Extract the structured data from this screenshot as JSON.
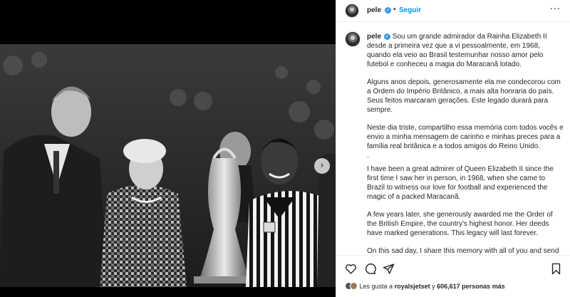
{
  "header": {
    "username": "pele",
    "separator": "•",
    "follow_label": "Seguir",
    "more_label": "···"
  },
  "caption": {
    "username": "pele",
    "paragraphs": [
      "Sou um grande admirador da Rainha Elizabeth II desde a primeira vez que a vi pessoalmente, em 1968, quando ela veio ao Brasil testemunhar nosso amor pelo futebol e conheceu a magia do Maracanã lotado.",
      "Alguns anos depois, generosamente ela me condecorou com a Ordem do Império Britânico, a mais alta honraria do país. Seus feitos marcaram gerações. Este legado durará para sempre.",
      "Neste dia triste, compartilho essa memória com todos vocês e envio a minha mensagem de carinho e minhas preces para a família real britânica e a todos amigos do Reino Unido.",
      ".",
      "I have been a great admirer of Queen Elizabeth II since the first time I saw her in person, in 1968, when she came to Brazil to witness our love for football and experienced the magic of a packed Maracanã.",
      "A few years later, she generously awarded me the Order of the British Empire, the country's highest honor. Her deeds have marked generations. This legacy will last forever.",
      "On this sad day, I share this memory with all of you and send my message of love and prayers to the British Royal Family and all friends in the United Kingdom."
    ]
  },
  "likes": {
    "prefix": "Les gusta a",
    "user": "royalsjetset",
    "connector": "y",
    "count_text": "606,617 personas más"
  },
  "media": {
    "next_label": "›"
  },
  "icons": {
    "like": "heart-icon",
    "comment": "comment-icon",
    "share": "paper-plane-icon",
    "save": "bookmark-icon",
    "verified": "verified-badge-icon"
  },
  "colors": {
    "accent": "#0095f6",
    "verified": "#3897f0",
    "text": "#262626"
  }
}
